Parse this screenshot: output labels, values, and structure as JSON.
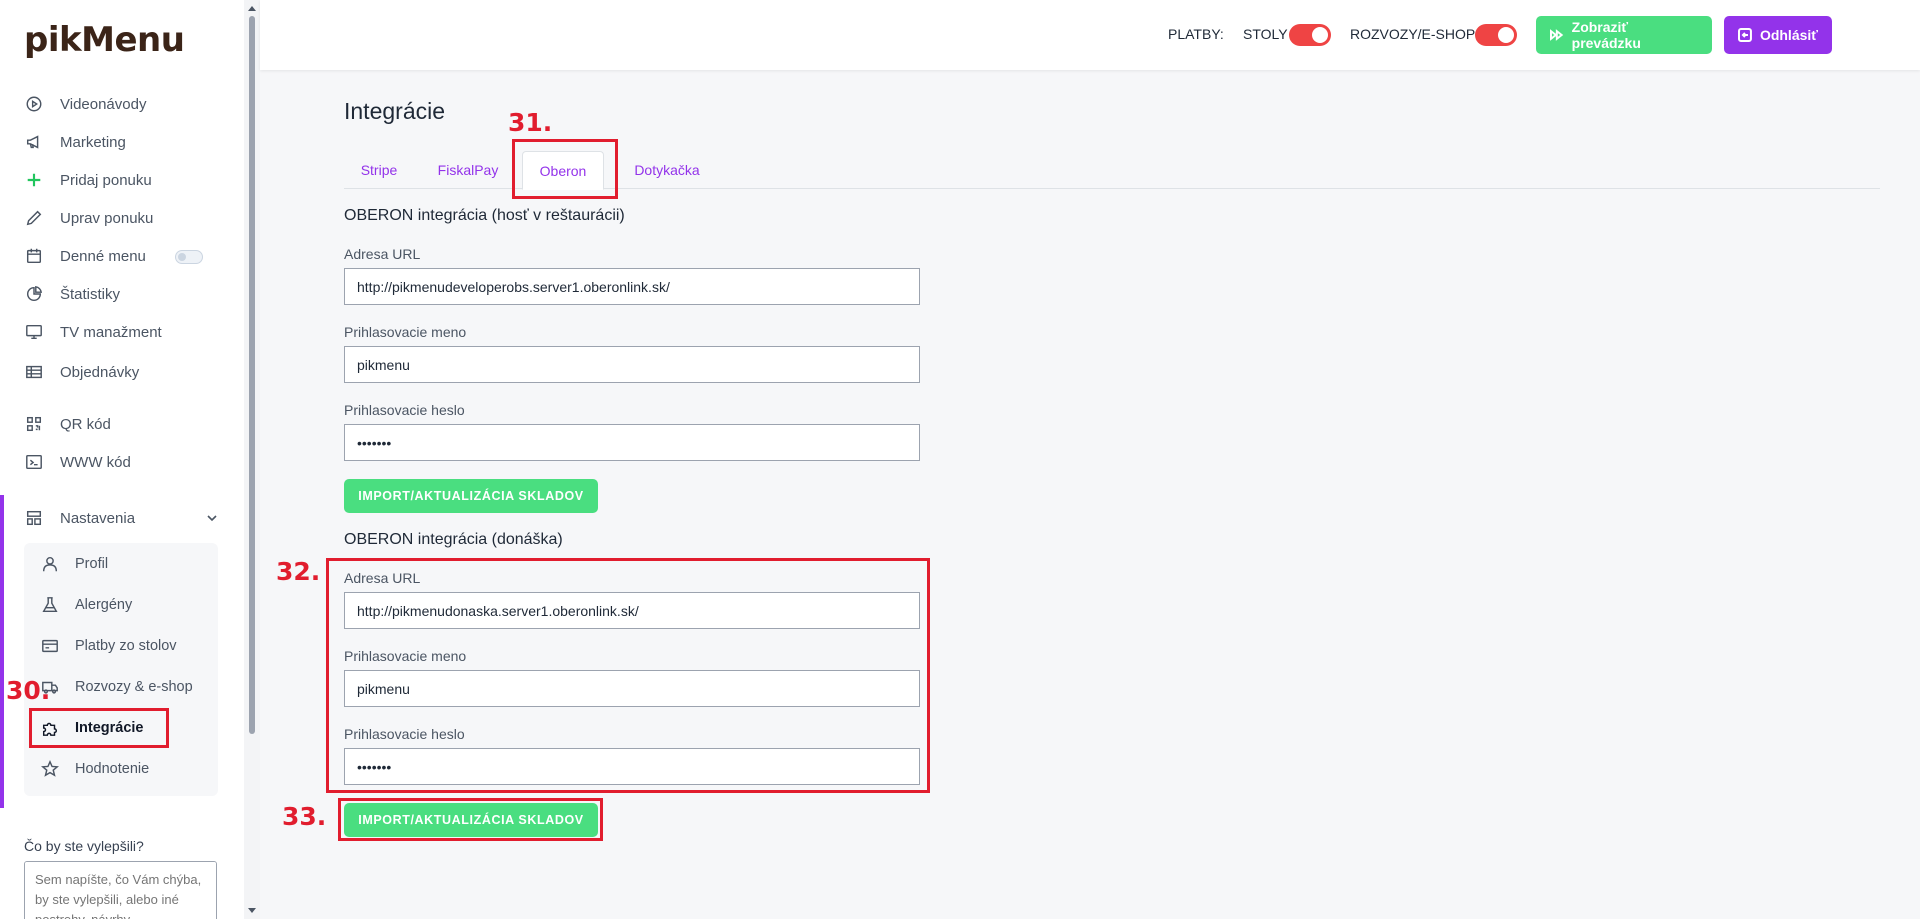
{
  "sidebar": {
    "logo": "pikMenu",
    "items": [
      {
        "label": "Videonávody",
        "icon": "play-circle-icon"
      },
      {
        "label": "Marketing",
        "icon": "megaphone-icon"
      },
      {
        "label": "Pridaj ponuku",
        "icon": "plus-icon"
      },
      {
        "label": "Uprav ponuku",
        "icon": "pencil-icon"
      },
      {
        "label": "Denné menu",
        "icon": "calendar-icon"
      },
      {
        "label": "Štatistiky",
        "icon": "pie-chart-icon"
      },
      {
        "label": "TV manažment",
        "icon": "monitor-icon"
      },
      {
        "label": "Objednávky",
        "icon": "table-icon"
      },
      {
        "label": "QR kód",
        "icon": "qr-code-icon"
      },
      {
        "label": "WWW kód",
        "icon": "code-window-icon"
      },
      {
        "label": "Nastavenia",
        "icon": "layout-icon"
      }
    ],
    "submenu": [
      {
        "label": "Profil",
        "icon": "user-icon"
      },
      {
        "label": "Alergény",
        "icon": "flask-icon"
      },
      {
        "label": "Platby zo stolov",
        "icon": "credit-card-icon"
      },
      {
        "label": "Rozvozy & e-shop",
        "icon": "truck-icon"
      },
      {
        "label": "Integrácie",
        "icon": "puzzle-icon"
      },
      {
        "label": "Hodnotenie",
        "icon": "star-icon"
      }
    ],
    "feedback": {
      "label": "Čo by ste vylepšili?",
      "placeholder": "Sem napíšte, čo Vám chýba, by ste vylepšili, alebo iné postrehy, návrhy"
    }
  },
  "topbar": {
    "payments_label": "PLATBY:",
    "tables_label": "STOLY",
    "tables_on": true,
    "delivery_label": "ROZVOZY/E-SHOP",
    "delivery_on": true,
    "show_store_button": "Zobraziť prevádzku",
    "logout_button": "Odhlásiť"
  },
  "main": {
    "title": "Integrácie",
    "tabs": [
      {
        "label": "Stripe",
        "active": false
      },
      {
        "label": "FiskalPay",
        "active": false
      },
      {
        "label": "Oberon",
        "active": true
      },
      {
        "label": "Dotykačka",
        "active": false
      }
    ],
    "section1": {
      "title": "OBERON integrácia (hosť v reštaurácii)",
      "url_label": "Adresa URL",
      "url_value": "http://pikmenudeveloperobs.server1.oberonlink.sk/",
      "user_label": "Prihlasovacie meno",
      "user_value": "pikmenu",
      "pass_label": "Prihlasovacie heslo",
      "pass_value": "•••••••",
      "button": "IMPORT/AKTUALIZÁCIA SKLADOV"
    },
    "section2": {
      "title": "OBERON integrácia (donáška)",
      "url_label": "Adresa URL",
      "url_value": "http://pikmenudonaska.server1.oberonlink.sk/",
      "user_label": "Prihlasovacie meno",
      "user_value": "pikmenu",
      "pass_label": "Prihlasovacie heslo",
      "pass_value": "•••••••",
      "button": "IMPORT/AKTUALIZÁCIA SKLADOV"
    }
  },
  "annotations": {
    "n30": "30.",
    "n31": "31.",
    "n32": "32.",
    "n33": "33."
  },
  "colors": {
    "accent_purple": "#9333ea",
    "green": "#4ade80",
    "toggle_red": "#ef4444",
    "annotation_red": "#e11d2e"
  }
}
